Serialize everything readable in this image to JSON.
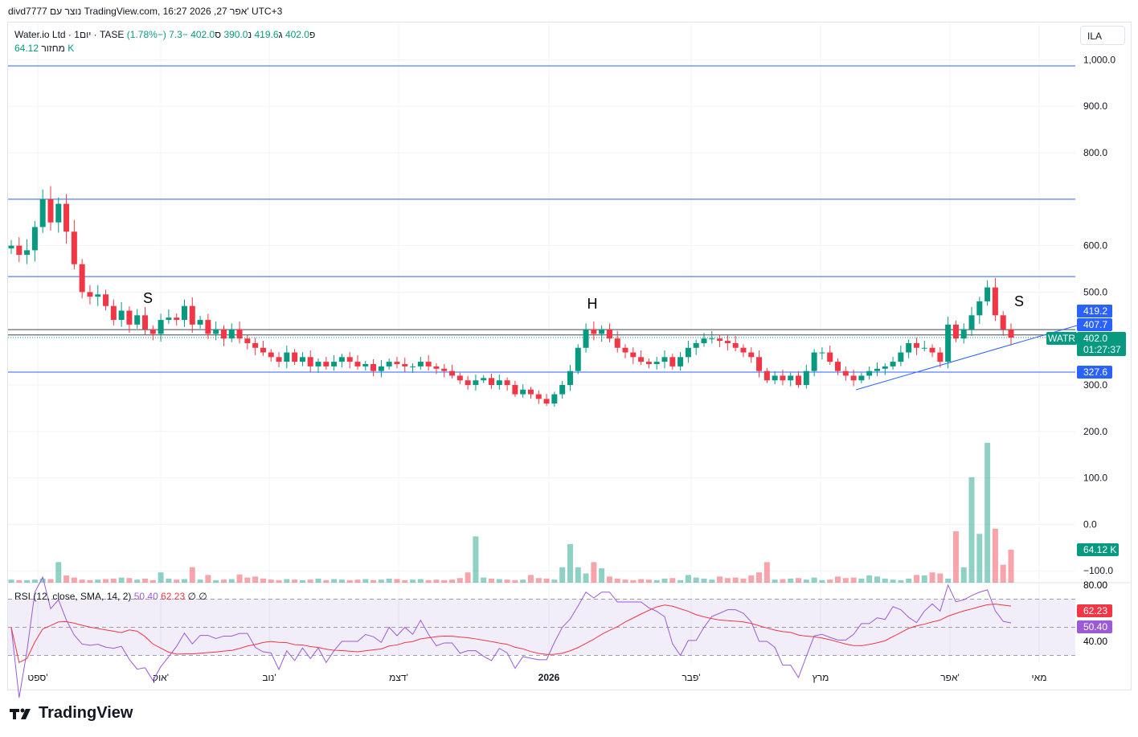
{
  "header": {
    "text": "divd7777 נוצר עם TradingView.com, 16:27 2026 ,27 אפר' UTC+3"
  },
  "legend": {
    "symbol": "Water.io Ltd · 1יום · TASE",
    "open_label": "פ",
    "open": "402.0",
    "high_label": "ג",
    "high": "419.6",
    "low_label": "נ",
    "low": "390.0",
    "close_label": "ס",
    "close": "402.0",
    "change": "−7.3 (−1.78%)",
    "volume_label": "מחזור",
    "volume": "64.12 K"
  },
  "currency": "ILA",
  "price_axis": {
    "ticks": [
      "1,000.0",
      "900.0",
      "800.0",
      "600.0",
      "500.0",
      "300.0",
      "200.0",
      "100.0",
      "0.0",
      "−100.0"
    ],
    "tick_values": [
      1000,
      900,
      800,
      600,
      500,
      300,
      200,
      100,
      0,
      -100
    ]
  },
  "levels": [
    {
      "label": "986.9",
      "value": 986.9
    },
    {
      "label": "699.9",
      "value": 699.9
    },
    {
      "label": "533.3",
      "value": 533.3
    },
    {
      "label": "419.2",
      "value": 419.2
    },
    {
      "label": "407.7",
      "value": 407.7
    },
    {
      "label": "327.6",
      "value": 327.6
    }
  ],
  "last_price": {
    "symbol": "WATR",
    "price": "402.0",
    "countdown": "01:27:37",
    "value": 402
  },
  "volume_badge": "64.12 K",
  "pattern_labels": [
    {
      "text": "S"
    },
    {
      "text": "H"
    },
    {
      "text": "S"
    }
  ],
  "rsi": {
    "label": "RSI (12, close, SMA, 14, 2)",
    "value": "50.40",
    "sma": "62.23",
    "e1": "∅",
    "e2": "∅",
    "ticks": [
      "80.00",
      "40.00"
    ],
    "badge_rsi": "50.40",
    "badge_sma": "62.23"
  },
  "months": [
    "ספט'",
    "אוק'",
    "נוב'",
    "דצמ'",
    "2026",
    "פבר'",
    "מרץ",
    "אפר'",
    "מאי"
  ],
  "colors": {
    "up": "#089981",
    "down": "#f23645",
    "line": "#2962ff",
    "rsi": "#9c5ad6",
    "sma": "#f23645"
  },
  "brand": "TradingView",
  "chart_data": {
    "type": "candlestick",
    "closes": [
      600,
      580,
      590,
      640,
      700,
      650,
      690,
      630,
      560,
      500,
      490,
      495,
      470,
      440,
      460,
      430,
      450,
      420,
      410,
      440,
      445,
      440,
      470,
      430,
      440,
      410,
      420,
      400,
      420,
      400,
      390,
      380,
      370,
      360,
      350,
      370,
      350,
      360,
      340,
      350,
      340,
      350,
      360,
      350,
      340,
      345,
      330,
      340,
      350,
      345,
      340,
      340,
      350,
      340,
      335,
      330,
      320,
      310,
      300,
      310,
      315,
      300,
      310,
      300,
      280,
      290,
      280,
      270,
      260,
      280,
      300,
      330,
      380,
      420,
      410,
      420,
      400,
      380,
      370,
      360,
      350,
      345,
      350,
      360,
      340,
      360,
      380,
      390,
      400,
      400,
      395,
      390,
      380,
      370,
      360,
      330,
      310,
      320,
      310,
      320,
      300,
      330,
      370,
      370,
      350,
      330,
      320,
      310,
      320,
      330,
      335,
      340,
      350,
      370,
      390,
      380,
      380,
      370,
      350,
      430,
      400,
      420,
      450,
      480,
      510,
      450,
      420,
      402
    ],
    "volumes_k": [
      6,
      5,
      5,
      6,
      8,
      7,
      40,
      14,
      10,
      6,
      5,
      6,
      7,
      8,
      10,
      9,
      6,
      8,
      5,
      20,
      8,
      6,
      7,
      30,
      6,
      15,
      5,
      6,
      7,
      16,
      10,
      12,
      8,
      6,
      5,
      7,
      6,
      5,
      6,
      8,
      5,
      7,
      6,
      5,
      6,
      7,
      5,
      6,
      8,
      7,
      5,
      6,
      7,
      5,
      6,
      5,
      6,
      9,
      20,
      90,
      10,
      8,
      7,
      6,
      5,
      6,
      15,
      9,
      8,
      6,
      30,
      75,
      30,
      18,
      40,
      28,
      12,
      8,
      6,
      5,
      7,
      6,
      5,
      8,
      9,
      5,
      15,
      10,
      8,
      6,
      12,
      9,
      10,
      8,
      14,
      20,
      40,
      6,
      7,
      8,
      9,
      6,
      10,
      5,
      6,
      12,
      9,
      10,
      8,
      14,
      12,
      8,
      6,
      5,
      8,
      15,
      14,
      20,
      18,
      8,
      100,
      30,
      205,
      95,
      272,
      105,
      35,
      64.12
    ]
  }
}
